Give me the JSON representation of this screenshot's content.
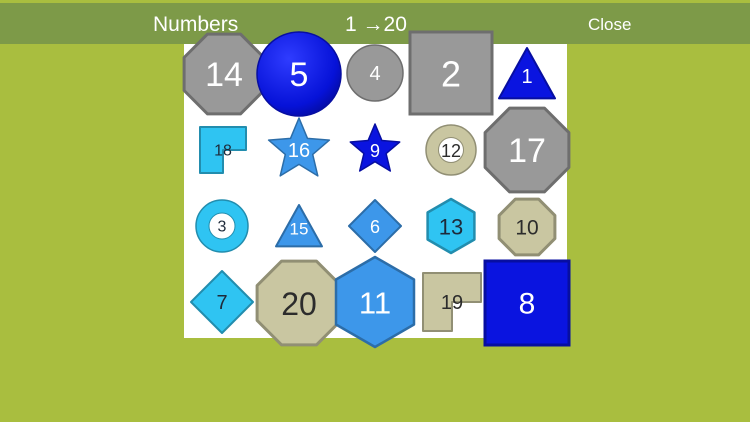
{
  "header": {
    "title": "Numbers",
    "range": "1 →20",
    "close_label": "Close"
  },
  "colors": {
    "background": "#a9be3f",
    "topbar": "#7d9a48",
    "board": "#ffffff",
    "gray": "#999999",
    "blue": "#0a14e0",
    "lightblue": "#2fc4f2",
    "midblue": "#3d97ea",
    "beige": "#c9c6a1"
  },
  "pieces": [
    {
      "number": "14",
      "shape": "octagon",
      "color": "gray"
    },
    {
      "number": "5",
      "shape": "circle",
      "color": "blue"
    },
    {
      "number": "4",
      "shape": "circle",
      "color": "gray"
    },
    {
      "number": "2",
      "shape": "square",
      "color": "gray"
    },
    {
      "number": "1",
      "shape": "triangle",
      "color": "blue"
    },
    {
      "number": "18",
      "shape": "notched-square",
      "color": "lightblue"
    },
    {
      "number": "16",
      "shape": "star",
      "color": "midblue"
    },
    {
      "number": "9",
      "shape": "star",
      "color": "blue"
    },
    {
      "number": "12",
      "shape": "ring",
      "color": "beige"
    },
    {
      "number": "17",
      "shape": "octagon",
      "color": "gray"
    },
    {
      "number": "3",
      "shape": "ring",
      "color": "lightblue"
    },
    {
      "number": "15",
      "shape": "triangle",
      "color": "midblue"
    },
    {
      "number": "6",
      "shape": "diamond",
      "color": "midblue"
    },
    {
      "number": "13",
      "shape": "hexagon",
      "color": "lightblue"
    },
    {
      "number": "10",
      "shape": "octagon",
      "color": "beige"
    },
    {
      "number": "7",
      "shape": "diamond",
      "color": "lightblue"
    },
    {
      "number": "20",
      "shape": "octagon",
      "color": "beige"
    },
    {
      "number": "11",
      "shape": "hexagon",
      "color": "midblue"
    },
    {
      "number": "19",
      "shape": "notched-square",
      "color": "beige"
    },
    {
      "number": "8",
      "shape": "square",
      "color": "blue"
    }
  ]
}
